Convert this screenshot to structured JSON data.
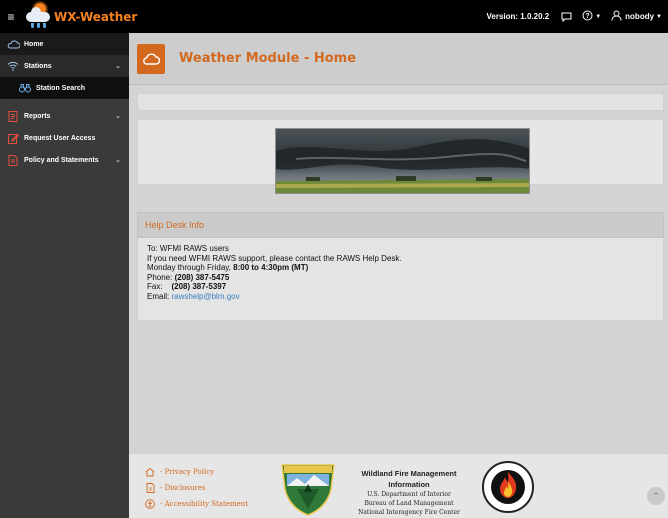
{
  "app": {
    "title": "WX-Weather",
    "version": "Version: 1.0.20.2",
    "user": "nobody"
  },
  "sidebar": {
    "items": [
      {
        "label": "Home",
        "icon": "cloud-icon"
      },
      {
        "label": "Stations",
        "icon": "wifi-icon"
      },
      {
        "label": "Station Search",
        "icon": "binoculars-icon"
      },
      {
        "label": "Reports",
        "icon": "report-icon"
      },
      {
        "label": "Request User Access",
        "icon": "edit-icon"
      },
      {
        "label": "Policy and Statements",
        "icon": "document-icon"
      }
    ]
  },
  "main": {
    "title": "Weather Module - Home",
    "help": {
      "heading": "Help Desk Info",
      "line1": "To: WFMI RAWS users",
      "line2": "If you need WFMI RAWS support, please contact the RAWS Help Desk.",
      "hours_prefix": "Monday through Friday, ",
      "hours": "8:00 to 4:30pm (MT)",
      "phone_label": "Phone: ",
      "phone": "(208) 387-5475",
      "fax_label": "Fax:    ",
      "fax": "(208) 387-5397",
      "email_label": "Email: ",
      "email": "rawshelp@blm.gov"
    }
  },
  "footer": {
    "links": [
      {
        "label": "- Privacy Policy",
        "icon": "home-icon"
      },
      {
        "label": "- Disclosures",
        "icon": "document-icon"
      },
      {
        "label": "- Accessibility Statement",
        "icon": "accessibility-icon"
      }
    ],
    "info_title": "Wildland Fire Management Information",
    "info_lines": [
      "U.S. Department of Interior",
      "Bureau of Land Management",
      "National Interagency Fire Center"
    ]
  },
  "colors": {
    "accent": "#d2691e",
    "brand_orange": "#f5821f",
    "sidebar": "#3a3a3a",
    "topbar": "#000000",
    "link": "#3a7fc4"
  }
}
